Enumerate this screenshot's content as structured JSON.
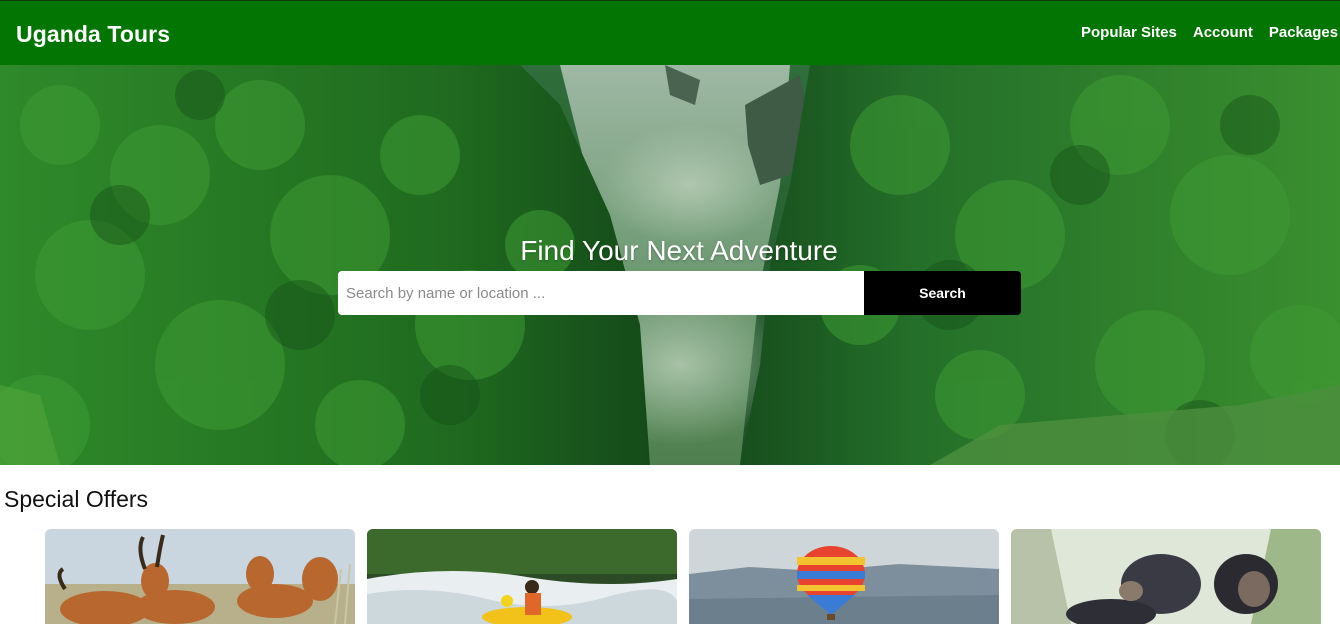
{
  "header": {
    "brand": "Uganda Tours",
    "nav": [
      "Popular Sites",
      "Account",
      "Packages"
    ]
  },
  "hero": {
    "title": "Find Your Next Adventure",
    "search_placeholder": "Search by name or location ...",
    "search_button": "Search"
  },
  "offers": {
    "title": "Special Offers",
    "cards": [
      {
        "image": "antelopes-photo"
      },
      {
        "image": "whitewater-rafting-photo"
      },
      {
        "image": "hot-air-balloon-photo"
      },
      {
        "image": "chimpanzee-photo"
      }
    ]
  },
  "colors": {
    "header_bg": "#037503",
    "search_button_bg": "#000000"
  }
}
